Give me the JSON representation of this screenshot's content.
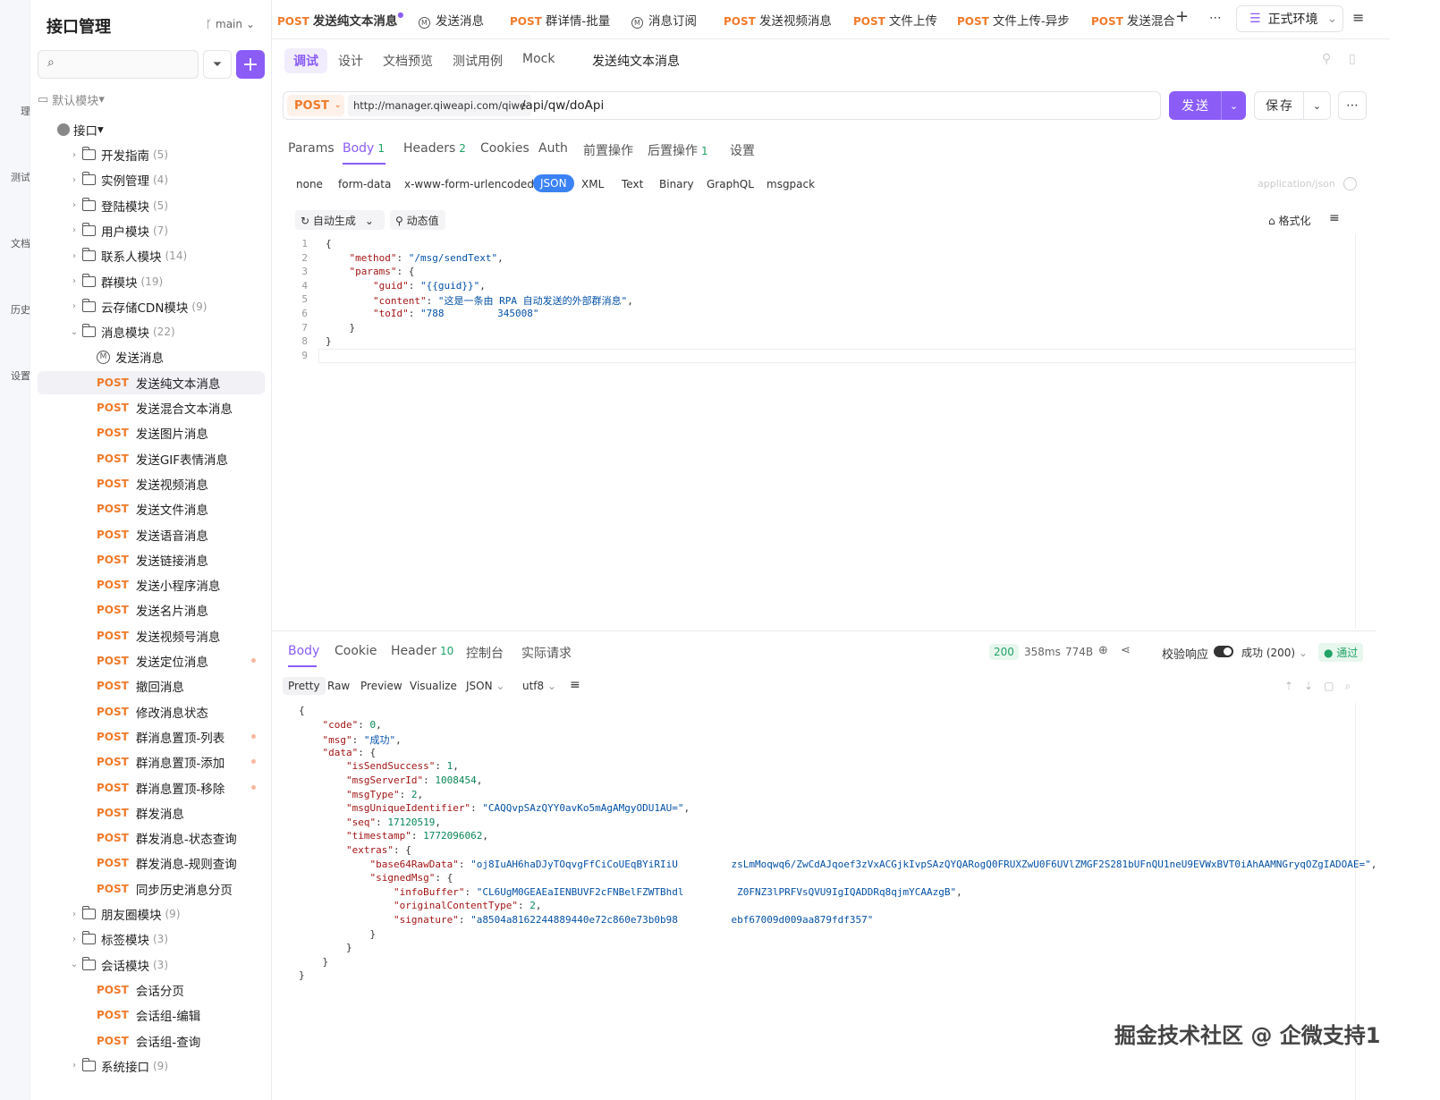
{
  "rail": {
    "items": [
      "理",
      "测试",
      "文档",
      "历史",
      "设置"
    ]
  },
  "sidebar": {
    "title": "接口管理",
    "branch": "main",
    "default_module": "默认模块",
    "root": "接口",
    "folders_top": [
      {
        "label": "开发指南",
        "count": "(5)"
      },
      {
        "label": "实例管理",
        "count": "(4)"
      },
      {
        "label": "登陆模块",
        "count": "(5)"
      },
      {
        "label": "用户模块",
        "count": "(7)"
      },
      {
        "label": "联系人模块",
        "count": "(14)"
      },
      {
        "label": "群模块",
        "count": "(19)"
      },
      {
        "label": "云存储CDN模块",
        "count": "(9)"
      },
      {
        "label": "消息模块",
        "count": "(22)"
      }
    ],
    "msg_doc": "发送消息",
    "msg_items": [
      "发送纯文本消息",
      "发送混合文本消息",
      "发送图片消息",
      "发送GIF表情消息",
      "发送视频消息",
      "发送文件消息",
      "发送语音消息",
      "发送链接消息",
      "发送小程序消息",
      "发送名片消息",
      "发送视频号消息",
      "发送定位消息",
      "撤回消息",
      "修改消息状态",
      "群消息置顶-列表",
      "群消息置顶-添加",
      "群消息置顶-移除",
      "群发消息",
      "群发消息-状态查询",
      "群发消息-规则查询",
      "同步历史消息分页"
    ],
    "folders_mid": [
      {
        "label": "朋友圈模块",
        "count": "(9)"
      },
      {
        "label": "标签模块",
        "count": "(3)"
      },
      {
        "label": "会话模块",
        "count": "(3)"
      }
    ],
    "session_items": [
      "会话分页",
      "会话组-编辑",
      "会话组-查询"
    ],
    "folders_bottom": [
      {
        "label": "系统接口",
        "count": "(9)"
      }
    ],
    "post": "POST"
  },
  "tabs": [
    {
      "m": "POST",
      "label": "发送纯文本消息"
    },
    {
      "m": "",
      "label": "发送消息"
    },
    {
      "m": "POST",
      "label": "群详情-批量"
    },
    {
      "m": "",
      "label": "消息订阅"
    },
    {
      "m": "POST",
      "label": "发送视频消息"
    },
    {
      "m": "POST",
      "label": "文件上传"
    },
    {
      "m": "POST",
      "label": "文件上传-异步"
    },
    {
      "m": "POST",
      "label": "发送混合"
    }
  ],
  "env": "正式环境",
  "subtabs": [
    "调试",
    "设计",
    "文档预览",
    "测试用例",
    "Mock"
  ],
  "api_name": "发送纯文本消息",
  "request": {
    "method": "POST",
    "base_url": "http://manager.qiweapi.com/qiwe",
    "path": "/api/qw/doApi",
    "send": "发送",
    "save": "保存"
  },
  "req_tabs": [
    {
      "label": "Params",
      "n": ""
    },
    {
      "label": "Body",
      "n": "1"
    },
    {
      "label": "Headers",
      "n": "2"
    },
    {
      "label": "Cookies",
      "n": ""
    },
    {
      "label": "Auth",
      "n": ""
    },
    {
      "label": "前置操作",
      "n": ""
    },
    {
      "label": "后置操作",
      "n": "1"
    },
    {
      "label": "设置",
      "n": ""
    }
  ],
  "body_types": [
    "none",
    "form-data",
    "x-www-form-urlencoded",
    "JSON",
    "XML",
    "Text",
    "Binary",
    "GraphQL",
    "msgpack"
  ],
  "content_type": "application/json",
  "editor_tools": {
    "auto": "自动生成",
    "dynamic": "动态值",
    "format": "格式化"
  },
  "request_body": [
    "{",
    "    \"method\": \"/msg/sendText\",",
    "    \"params\": {",
    "        \"guid\": \"{{guid}}\",",
    "        \"content\": \"这是一条由 RPA 自动发送的外部群消息\",",
    "        \"toId\": \"788         345008\"",
    "    }",
    "}",
    ""
  ],
  "resp_tabs": [
    {
      "label": "Body",
      "n": ""
    },
    {
      "label": "Cookie",
      "n": ""
    },
    {
      "label": "Header",
      "n": "10"
    },
    {
      "label": "控制台",
      "n": ""
    },
    {
      "label": "实际请求",
      "n": ""
    }
  ],
  "resp_meta": {
    "status": "200",
    "time": "358ms",
    "size": "774B",
    "validate": "校验响应",
    "result": "成功 (200)",
    "pass": "通过"
  },
  "view_modes": [
    "Pretty",
    "Raw",
    "Preview",
    "Visualize"
  ],
  "format": "JSON",
  "encoding": "utf8",
  "response_body": [
    "{",
    "    \"code\": 0,",
    "    \"msg\": \"成功\",",
    "    \"data\": {",
    "        \"isSendSuccess\": 1,",
    "        \"msgServerId\": 1008454,",
    "        \"msgType\": 2,",
    "        \"msgUniqueIdentifier\": \"CAQQvpSAzQYY0avKo5mAgAMgyODU1AU=\",",
    "        \"seq\": 17120519,",
    "        \"timestamp\": 1772096062,",
    "        \"extras\": {",
    "            \"base64RawData\": \"oj8IuAH6haDJyTOqvgFfCiCoUEqBYiRIiU         zsLmMoqwq6/ZwCdAJqoef3zVxACGjkIvpSAzQYQARogQ0FRUXZwU0F6UVlZMGF2S281bUFnQU1neU9EVWxBVT0iAhAAMNGryqOZgIADOAE=\",",
    "            \"signedMsg\": {",
    "                \"infoBuffer\": \"CL6UgM0GEAEaIENBUVF2cFNBelFZWTBhdl         Z0FNZ3lPRFVsQVU9IgIQADDRq8qjmYCAAzgB\",",
    "                \"originalContentType\": 2,",
    "                \"signature\": \"a8504a8162244889440e72c860e73b0b98         ebf67009d009aa879fdf357\"",
    "            }",
    "        }",
    "    }",
    "}"
  ],
  "watermark": "掘金技术社区 @ 企微支持1"
}
